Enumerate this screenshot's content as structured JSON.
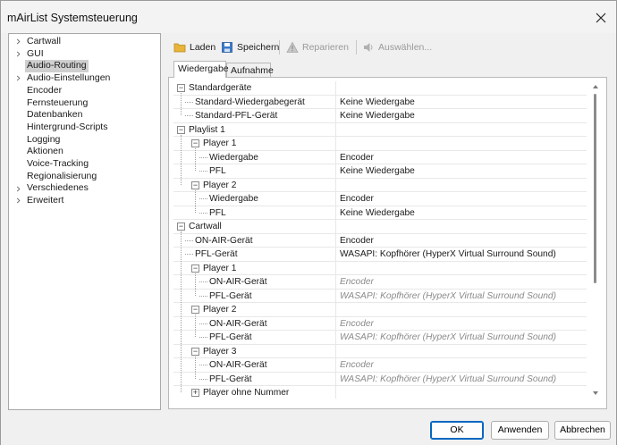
{
  "window": {
    "title": "mAirList Systemsteuerung"
  },
  "nav": {
    "items": [
      {
        "label": "Cartwall",
        "expandable": true,
        "selected": false
      },
      {
        "label": "GUI",
        "expandable": true,
        "selected": false
      },
      {
        "label": "Audio-Routing",
        "expandable": false,
        "selected": true
      },
      {
        "label": "Audio-Einstellungen",
        "expandable": true,
        "selected": false
      },
      {
        "label": "Encoder",
        "expandable": false,
        "selected": false
      },
      {
        "label": "Fernsteuerung",
        "expandable": false,
        "selected": false
      },
      {
        "label": "Datenbanken",
        "expandable": false,
        "selected": false
      },
      {
        "label": "Hintergrund-Scripts",
        "expandable": false,
        "selected": false
      },
      {
        "label": "Logging",
        "expandable": false,
        "selected": false
      },
      {
        "label": "Aktionen",
        "expandable": false,
        "selected": false
      },
      {
        "label": "Voice-Tracking",
        "expandable": false,
        "selected": false
      },
      {
        "label": "Regionalisierung",
        "expandable": false,
        "selected": false
      },
      {
        "label": "Verschiedenes",
        "expandable": true,
        "selected": false
      },
      {
        "label": "Erweitert",
        "expandable": true,
        "selected": false
      }
    ]
  },
  "toolbar": {
    "load_label": "Laden",
    "save_label": "Speichern",
    "repair_label": "Reparieren",
    "select_label": "Auswählen..."
  },
  "tabs": [
    {
      "label": "Wiedergabe",
      "active": true
    },
    {
      "label": "Aufnahme",
      "active": false
    }
  ],
  "routing": {
    "rows": [
      {
        "name": "Standardgeräte",
        "value": "",
        "level": 0,
        "expander": "minus"
      },
      {
        "name": "Standard-Wiedergabegerät",
        "value": "Keine Wiedergabe",
        "level": 1,
        "expander": ""
      },
      {
        "name": "Standard-PFL-Gerät",
        "value": "Keine Wiedergabe",
        "level": 1,
        "expander": ""
      },
      {
        "name": "Playlist 1",
        "value": "",
        "level": 0,
        "expander": "minus"
      },
      {
        "name": "Player 1",
        "value": "",
        "level": 1,
        "expander": "minus"
      },
      {
        "name": "Wiedergabe",
        "value": "Encoder",
        "level": 2,
        "expander": ""
      },
      {
        "name": "PFL",
        "value": "Keine Wiedergabe",
        "level": 2,
        "expander": ""
      },
      {
        "name": "Player 2",
        "value": "",
        "level": 1,
        "expander": "minus"
      },
      {
        "name": "Wiedergabe",
        "value": "Encoder",
        "level": 2,
        "expander": ""
      },
      {
        "name": "PFL",
        "value": "Keine Wiedergabe",
        "level": 2,
        "expander": ""
      },
      {
        "name": "Cartwall",
        "value": "",
        "level": 0,
        "expander": "minus"
      },
      {
        "name": "ON-AIR-Gerät",
        "value": "Encoder",
        "level": 1,
        "expander": ""
      },
      {
        "name": "PFL-Gerät",
        "value": "WASAPI: Kopfhörer (HyperX Virtual Surround Sound)",
        "level": 1,
        "expander": ""
      },
      {
        "name": "Player 1",
        "value": "",
        "level": 1,
        "expander": "minus"
      },
      {
        "name": "ON-AIR-Gerät",
        "value": "Encoder",
        "level": 2,
        "expander": "",
        "inherited": true
      },
      {
        "name": "PFL-Gerät",
        "value": "WASAPI: Kopfhörer (HyperX Virtual Surround Sound)",
        "level": 2,
        "expander": "",
        "inherited": true
      },
      {
        "name": "Player 2",
        "value": "",
        "level": 1,
        "expander": "minus"
      },
      {
        "name": "ON-AIR-Gerät",
        "value": "Encoder",
        "level": 2,
        "expander": "",
        "inherited": true
      },
      {
        "name": "PFL-Gerät",
        "value": "WASAPI: Kopfhörer (HyperX Virtual Surround Sound)",
        "level": 2,
        "expander": "",
        "inherited": true
      },
      {
        "name": "Player 3",
        "value": "",
        "level": 1,
        "expander": "minus"
      },
      {
        "name": "ON-AIR-Gerät",
        "value": "Encoder",
        "level": 2,
        "expander": "",
        "inherited": true
      },
      {
        "name": "PFL-Gerät",
        "value": "WASAPI: Kopfhörer (HyperX Virtual Surround Sound)",
        "level": 2,
        "expander": "",
        "inherited": true
      },
      {
        "name": "Player ohne Nummer",
        "value": "",
        "level": 1,
        "expander": "plus"
      }
    ]
  },
  "footer": {
    "ok_label": "OK",
    "apply_label": "Anwenden",
    "cancel_label": "Abbrechen"
  },
  "colors": {
    "accent": "#0067c0",
    "selection": "#cfcfcf",
    "inherited_text": "#8a8a8a"
  }
}
